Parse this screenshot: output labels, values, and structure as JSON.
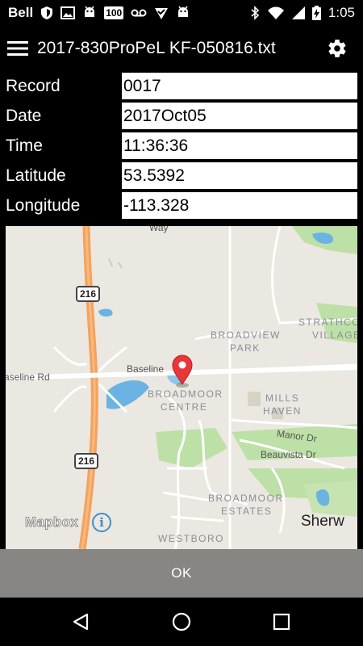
{
  "status_bar": {
    "carrier": "Bell",
    "time": "1:05",
    "badge_number": "100",
    "left_icons": [
      "shield-icon",
      "image-icon",
      "android-icon",
      "badge-100-icon",
      "voicemail-icon",
      "checklist-icon",
      "android-icon"
    ],
    "right_icons": [
      "bluetooth-icon",
      "wifi-icon",
      "signal-icon",
      "battery-charging-icon"
    ]
  },
  "app_bar": {
    "title": "2017-830ProPeL KF-050816.txt",
    "menu_icon": "hamburger-menu-icon",
    "settings_icon": "gear-icon"
  },
  "form": {
    "fields": [
      {
        "label": "Record",
        "value": "0017"
      },
      {
        "label": "Date",
        "value": "2017Oct05"
      },
      {
        "label": "Time",
        "value": "11:36:36"
      },
      {
        "label": "Latitude",
        "value": "53.5392"
      },
      {
        "label": "Longitude",
        "value": "-113.328"
      }
    ]
  },
  "map": {
    "attribution": "Mapbox",
    "info_icon": "info-icon",
    "marker_icon": "location-pin-icon",
    "highway_shield_1": "216",
    "highway_shield_2": "216",
    "places": {
      "broadview_1": "BROADVIEW",
      "broadview_2": "PARK",
      "strathcona_1": "STRATHCO",
      "strathcona_2": "VILLAGE",
      "broadmoor_centre_1": "BROADMOOR",
      "broadmoor_centre_2": "CENTRE",
      "mills_1": "MILLS",
      "mills_2": "HAVEN",
      "broadmoor_estates_1": "BROADMOOR",
      "broadmoor_estates_2": "ESTATES",
      "westboro": "WESTBORO",
      "sherwood": "Sherw"
    },
    "roads": {
      "baseline_left": "aseline Rd",
      "baseline_mid": "Baseline",
      "manor": "Manor Dr",
      "beauvista": "Beauvista Dr",
      "way": "Way"
    },
    "colors": {
      "land": "#ebe7e1",
      "park": "#bde0a6",
      "water": "#6ab3e2",
      "highway": "#f4a25c",
      "marker": "#e8373a"
    }
  },
  "ok_button": {
    "label": "OK"
  },
  "nav_bar": {
    "back_icon": "back-triangle-icon",
    "home_icon": "home-circle-icon",
    "recents_icon": "recents-square-icon"
  }
}
